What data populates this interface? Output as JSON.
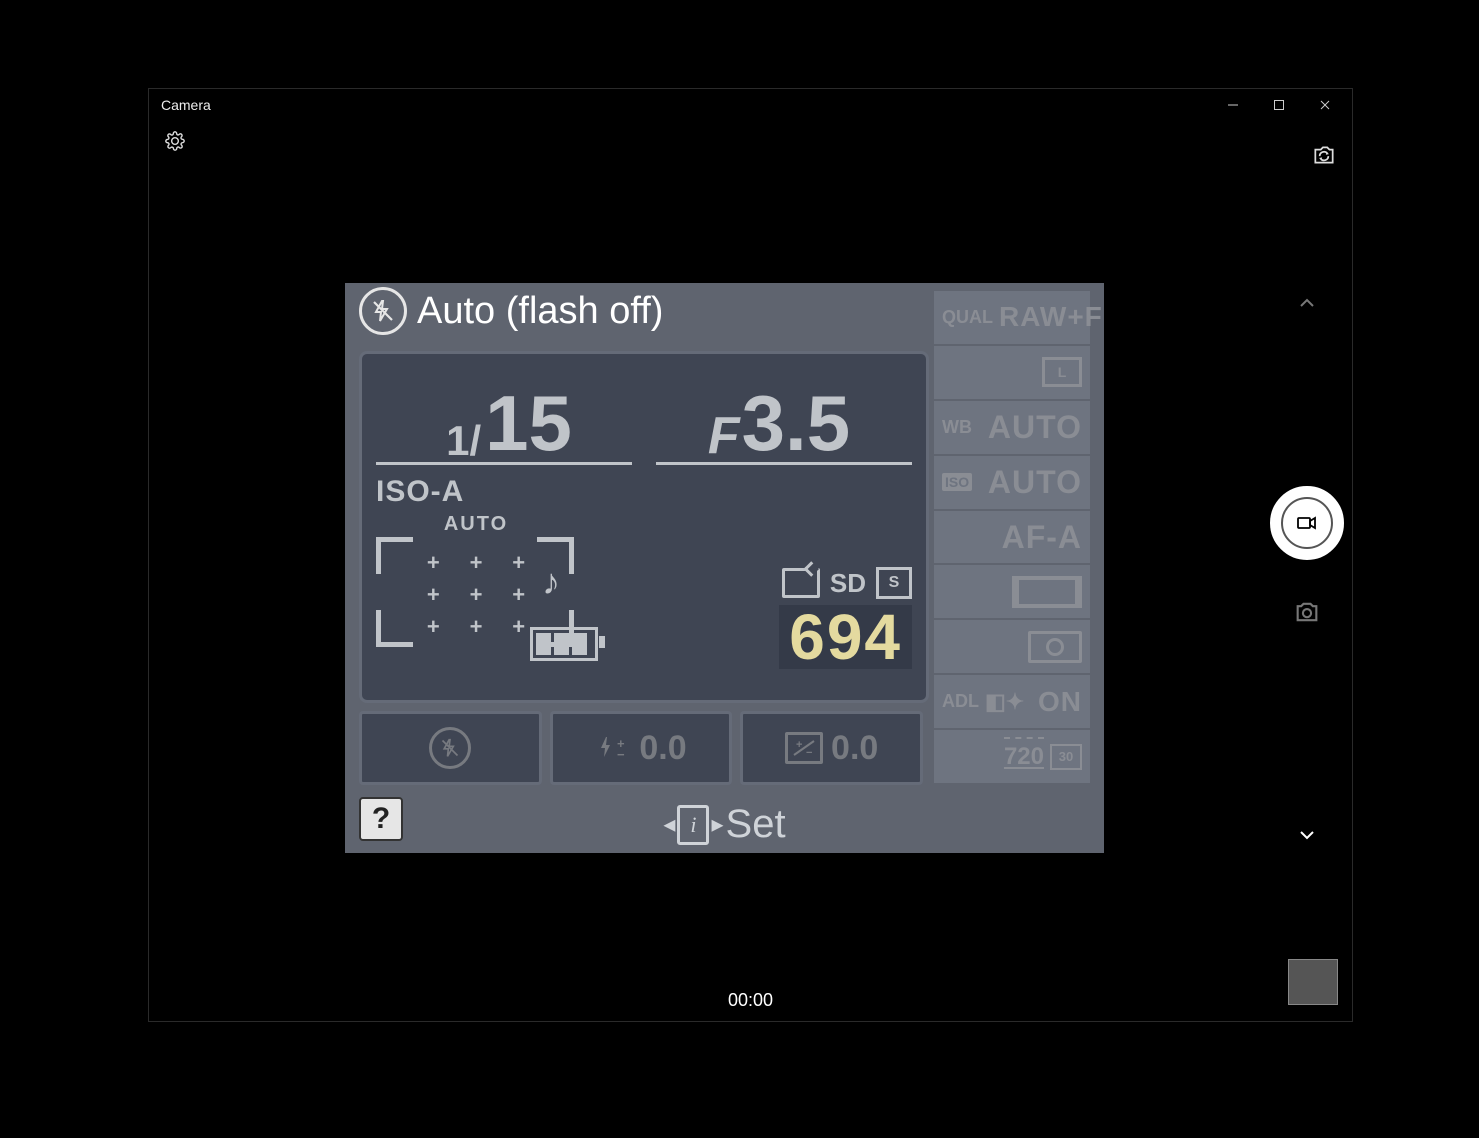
{
  "window": {
    "title": "Camera"
  },
  "timer": "00:00",
  "lcd": {
    "mode": "Auto (flash off)",
    "shutter_numerator": "1/",
    "shutter_denominator": "15",
    "aperture_prefix": "F",
    "aperture_value": "3.5",
    "iso_label": "ISO-A",
    "af_auto": "AUTO",
    "sd_label": "SD",
    "release_mode": "S",
    "shots_remaining": "694",
    "flash_comp": "0.0",
    "exposure_comp": "0.0"
  },
  "side": {
    "qual_label": "QUAL",
    "qual_value": "RAW+F",
    "size_value": "L",
    "wb_label": "WB",
    "wb_value": "AUTO",
    "iso_label": "ISO",
    "iso_value": "AUTO",
    "focus_mode": "AF-A",
    "adl_label": "ADL",
    "adl_value": "ON",
    "movie_res": "720",
    "movie_fps": "30"
  },
  "footer": {
    "set_label": "Set",
    "help": "?"
  }
}
